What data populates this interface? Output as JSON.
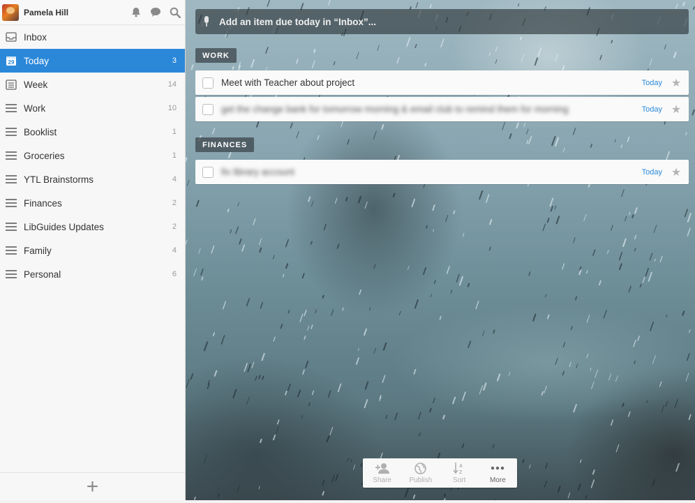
{
  "user": {
    "name": "Pamela Hill"
  },
  "header_icons": [
    "bell-icon",
    "speech-bubble-icon",
    "search-icon"
  ],
  "sidebar": {
    "items": [
      {
        "label": "Inbox",
        "count": "",
        "icon": "inbox-icon"
      },
      {
        "label": "Today",
        "count": "3",
        "icon": "calendar-icon",
        "calendar_day": "29",
        "active": true
      },
      {
        "label": "Week",
        "count": "14",
        "icon": "week-icon"
      },
      {
        "label": "Work",
        "count": "10",
        "icon": "list-icon"
      },
      {
        "label": "Booklist",
        "count": "1",
        "icon": "list-icon"
      },
      {
        "label": "Groceries",
        "count": "1",
        "icon": "list-icon"
      },
      {
        "label": "YTL Brainstorms",
        "count": "4",
        "icon": "list-icon"
      },
      {
        "label": "Finances",
        "count": "2",
        "icon": "list-icon"
      },
      {
        "label": "LibGuides Updates",
        "count": "2",
        "icon": "list-icon"
      },
      {
        "label": "Family",
        "count": "4",
        "icon": "list-icon"
      },
      {
        "label": "Personal",
        "count": "6",
        "icon": "list-icon"
      }
    ],
    "footer_add": "+"
  },
  "add_item": {
    "placeholder": "Add an item due today in “Inbox”..."
  },
  "sections": [
    {
      "label": "WORK",
      "tasks": [
        {
          "title": "Meet with Teacher about project",
          "due": "Today",
          "blurred": false
        },
        {
          "title": "get the change bank for tomorrow morning & email club to remind them for morning",
          "due": "Today",
          "blurred": true
        }
      ]
    },
    {
      "label": "FINANCES",
      "tasks": [
        {
          "title": "fix library account",
          "due": "Today",
          "blurred": true
        }
      ]
    }
  ],
  "toolbar": {
    "buttons": [
      {
        "label": "Share",
        "icon": "add-user-icon"
      },
      {
        "label": "Publish",
        "icon": "globe-icon"
      },
      {
        "label": "Sort",
        "icon": "sort-az-icon"
      },
      {
        "label": "More",
        "icon": "more-dots-icon"
      }
    ]
  },
  "colors": {
    "accent": "#2b88d9",
    "sidebar_bg": "#f7f7f7",
    "due_text": "#2b88d9"
  }
}
